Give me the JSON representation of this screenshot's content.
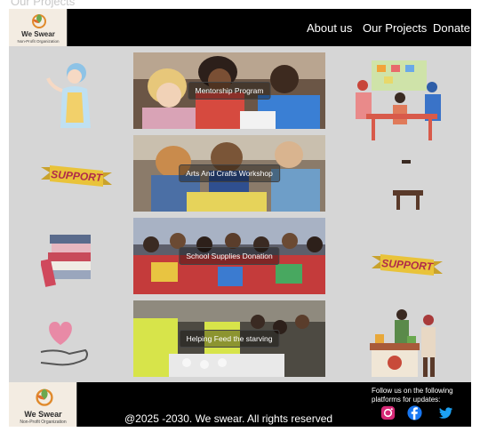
{
  "page_label": "Our Projects",
  "brand": {
    "name": "We Swear",
    "tagline": "Non-Profit Organization"
  },
  "nav": {
    "about": "About us",
    "projects": "Our Projects",
    "donate": "Donate"
  },
  "projects": [
    {
      "title": "Mentorship Program"
    },
    {
      "title": "Arts And Crafts Workshop"
    },
    {
      "title": "School Supplies Donation"
    },
    {
      "title": "Helping Feed the starving"
    }
  ],
  "illustrations": {
    "left": [
      "woman-apron-icon",
      "support-banner-icon",
      "stack-of-books-icon",
      "heart-in-hand-icon"
    ],
    "right": [
      "team-meeting-icon",
      "stool-icon",
      "support-banner-icon",
      "food-donation-icon"
    ],
    "banner_text": "SUPPORT"
  },
  "footer": {
    "copyright": "@2025 -2030. We swear. All rights reserved",
    "follow_text": "Follow us on the following platforms for updates:",
    "social": [
      "instagram-icon",
      "facebook-icon",
      "twitter-icon"
    ]
  },
  "colors": {
    "bar": "#000000",
    "panel": "#d6d6d6",
    "banner": "#e9c33a",
    "instagram": "#d62976",
    "facebook": "#1877f2",
    "twitter": "#1da1f2"
  }
}
